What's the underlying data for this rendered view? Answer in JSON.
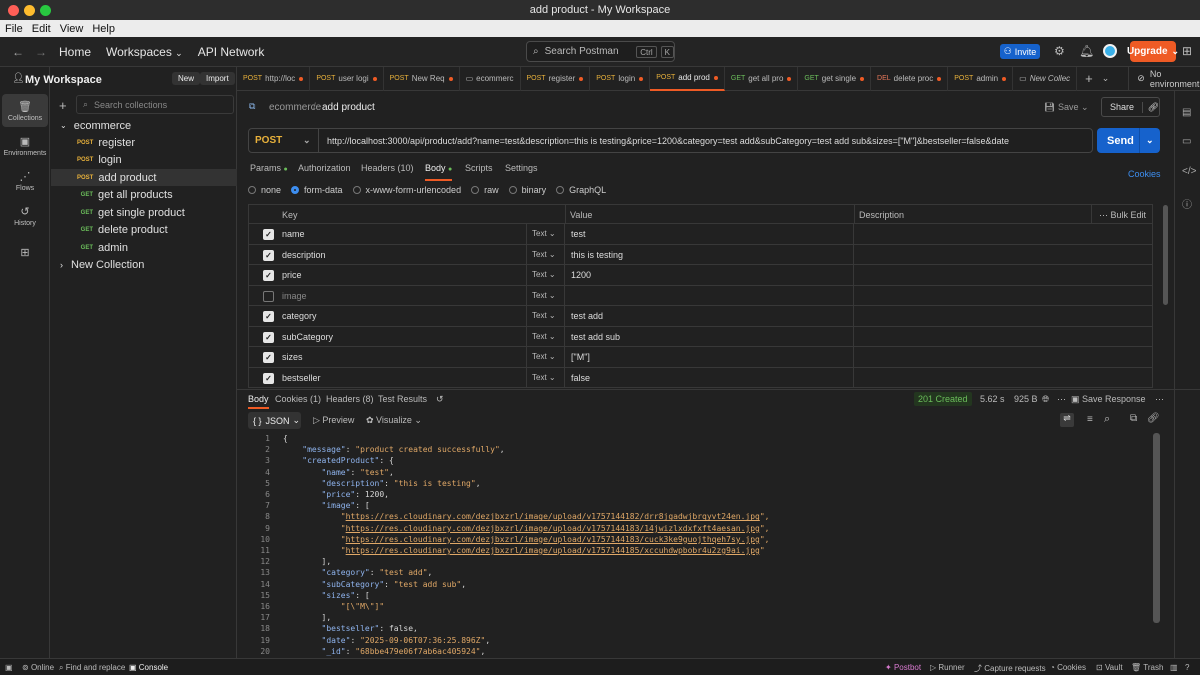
{
  "window": {
    "title": "add product - My Workspace"
  },
  "menu": [
    "File",
    "Edit",
    "View",
    "Help"
  ],
  "topnav": {
    "home": "Home",
    "workspaces": "Workspaces",
    "api_network": "API Network",
    "search_placeholder": "Search Postman",
    "kbd_ctrl": "Ctrl",
    "kbd_k": "K",
    "invite": "Invite",
    "upgrade": "Upgrade"
  },
  "rail": [
    {
      "label": "Collections",
      "icon": "collections-icon"
    },
    {
      "label": "Environments",
      "icon": "environments-icon"
    },
    {
      "label": "Flows",
      "icon": "flows-icon"
    },
    {
      "label": "History",
      "icon": "history-icon"
    }
  ],
  "sidebar": {
    "workspace": "My Workspace",
    "new": "New",
    "import": "Import",
    "search_placeholder": "Search collections",
    "collection": "ecommerce",
    "items": [
      {
        "method": "POST",
        "name": "register"
      },
      {
        "method": "POST",
        "name": "login"
      },
      {
        "method": "POST",
        "name": "add product"
      },
      {
        "method": "GET",
        "name": "get all products"
      },
      {
        "method": "GET",
        "name": "get single product"
      },
      {
        "method": "GET",
        "name": "delete product"
      },
      {
        "method": "GET",
        "name": "admin"
      }
    ],
    "new_collection": "New Collection"
  },
  "tabs": [
    {
      "method": "POST",
      "name": "http://loc"
    },
    {
      "method": "POST",
      "name": "user logi"
    },
    {
      "method": "POST",
      "name": "New Req"
    },
    {
      "method": "",
      "name": "ecommerc"
    },
    {
      "method": "POST",
      "name": "register"
    },
    {
      "method": "POST",
      "name": "login"
    },
    {
      "method": "POST",
      "name": "add prod"
    },
    {
      "method": "GET",
      "name": "get all pro"
    },
    {
      "method": "GET",
      "name": "get single"
    },
    {
      "method": "DEL",
      "name": "delete proc"
    },
    {
      "method": "POST",
      "name": "admin"
    },
    {
      "method": "",
      "name": "New Collec"
    }
  ],
  "environment": "No environment",
  "breadcrumb": {
    "collection": "ecommerce",
    "sep": "/",
    "request": "add product"
  },
  "actions": {
    "save": "Save",
    "share": "Share"
  },
  "request": {
    "method": "POST",
    "url": "http://localhost:3000/api/product/add?name=test&description=this is testing&price=1200&category=test add&subCategory=test add sub&sizes=[\"M\"]&bestseller=false&date",
    "send": "Send",
    "tabs": [
      "Params",
      "Authorization",
      "Headers (10)",
      "Body",
      "Scripts",
      "Settings"
    ],
    "cookies": "Cookies",
    "body_types": [
      "none",
      "form-data",
      "x-www-form-urlencoded",
      "raw",
      "binary",
      "GraphQL"
    ],
    "body_selected": "form-data"
  },
  "formdata": {
    "headers": {
      "key": "Key",
      "value": "Value",
      "description": "Description",
      "bulk": "Bulk Edit"
    },
    "rows": [
      {
        "checked": true,
        "key": "name",
        "type": "Text",
        "value": "test"
      },
      {
        "checked": true,
        "key": "description",
        "type": "Text",
        "value": "this is testing"
      },
      {
        "checked": true,
        "key": "price",
        "type": "Text",
        "value": "1200"
      },
      {
        "checked": false,
        "key": "image",
        "type": "Text",
        "value": ""
      },
      {
        "checked": true,
        "key": "category",
        "type": "Text",
        "value": "test add"
      },
      {
        "checked": true,
        "key": "subCategory",
        "type": "Text",
        "value": "test add sub"
      },
      {
        "checked": true,
        "key": "sizes",
        "type": "Text",
        "value": "[\"M\"]"
      },
      {
        "checked": true,
        "key": "bestseller",
        "type": "Text",
        "value": "false"
      }
    ]
  },
  "response": {
    "tabs": [
      "Body",
      "Cookies (1)",
      "Headers (8)",
      "Test Results"
    ],
    "status": "201 Created",
    "time": "5.62 s",
    "size": "925 B",
    "save": "Save Response",
    "format": "JSON",
    "preview": "Preview",
    "visualize": "Visualize",
    "lines": [
      [
        {
          "t": "{",
          "c": "n"
        }
      ],
      [
        {
          "t": "    ",
          "c": "n"
        },
        {
          "t": "\"message\"",
          "c": "k"
        },
        {
          "t": ": ",
          "c": "n"
        },
        {
          "t": "\"product created successfully\"",
          "c": "s"
        },
        {
          "t": ",",
          "c": "n"
        }
      ],
      [
        {
          "t": "    ",
          "c": "n"
        },
        {
          "t": "\"createdProduct\"",
          "c": "k"
        },
        {
          "t": ": {",
          "c": "n"
        }
      ],
      [
        {
          "t": "        ",
          "c": "n"
        },
        {
          "t": "\"name\"",
          "c": "k"
        },
        {
          "t": ": ",
          "c": "n"
        },
        {
          "t": "\"test\"",
          "c": "s"
        },
        {
          "t": ",",
          "c": "n"
        }
      ],
      [
        {
          "t": "        ",
          "c": "n"
        },
        {
          "t": "\"description\"",
          "c": "k"
        },
        {
          "t": ": ",
          "c": "n"
        },
        {
          "t": "\"this is testing\"",
          "c": "s"
        },
        {
          "t": ",",
          "c": "n"
        }
      ],
      [
        {
          "t": "        ",
          "c": "n"
        },
        {
          "t": "\"price\"",
          "c": "k"
        },
        {
          "t": ": 1200,",
          "c": "n"
        }
      ],
      [
        {
          "t": "        ",
          "c": "n"
        },
        {
          "t": "\"image\"",
          "c": "k"
        },
        {
          "t": ": [",
          "c": "n"
        }
      ],
      [
        {
          "t": "            \"",
          "c": "s"
        },
        {
          "t": "https://res.cloudinary.com/dezjbxzrl/image/upload/v1757144182/drr8jgadwjbrqyvt24en.jpg",
          "c": "u"
        },
        {
          "t": "\",",
          "c": "s"
        }
      ],
      [
        {
          "t": "            \"",
          "c": "s"
        },
        {
          "t": "https://res.cloudinary.com/dezjbxzrl/image/upload/v1757144183/14jwizlxdxfxft4aesan.jpg",
          "c": "u"
        },
        {
          "t": "\",",
          "c": "s"
        }
      ],
      [
        {
          "t": "            \"",
          "c": "s"
        },
        {
          "t": "https://res.cloudinary.com/dezjbxzrl/image/upload/v1757144183/cuck3ke9guojthqeh7sy.jpg",
          "c": "u"
        },
        {
          "t": "\",",
          "c": "s"
        }
      ],
      [
        {
          "t": "            \"",
          "c": "s"
        },
        {
          "t": "https://res.cloudinary.com/dezjbxzrl/image/upload/v1757144185/xccuhdwpbobr4u2zg9ai.jpg",
          "c": "u"
        },
        {
          "t": "\"",
          "c": "s"
        }
      ],
      [
        {
          "t": "        ],",
          "c": "n"
        }
      ],
      [
        {
          "t": "        ",
          "c": "n"
        },
        {
          "t": "\"category\"",
          "c": "k"
        },
        {
          "t": ": ",
          "c": "n"
        },
        {
          "t": "\"test add\"",
          "c": "s"
        },
        {
          "t": ",",
          "c": "n"
        }
      ],
      [
        {
          "t": "        ",
          "c": "n"
        },
        {
          "t": "\"subCategory\"",
          "c": "k"
        },
        {
          "t": ": ",
          "c": "n"
        },
        {
          "t": "\"test add sub\"",
          "c": "s"
        },
        {
          "t": ",",
          "c": "n"
        }
      ],
      [
        {
          "t": "        ",
          "c": "n"
        },
        {
          "t": "\"sizes\"",
          "c": "k"
        },
        {
          "t": ": [",
          "c": "n"
        }
      ],
      [
        {
          "t": "            ",
          "c": "n"
        },
        {
          "t": "\"[\\\"M\\\"]\"",
          "c": "s"
        }
      ],
      [
        {
          "t": "        ],",
          "c": "n"
        }
      ],
      [
        {
          "t": "        ",
          "c": "n"
        },
        {
          "t": "\"bestseller\"",
          "c": "k"
        },
        {
          "t": ": false,",
          "c": "n"
        }
      ],
      [
        {
          "t": "        ",
          "c": "n"
        },
        {
          "t": "\"date\"",
          "c": "k"
        },
        {
          "t": ": ",
          "c": "n"
        },
        {
          "t": "\"2025-09-06T07:36:25.896Z\"",
          "c": "s"
        },
        {
          "t": ",",
          "c": "n"
        }
      ],
      [
        {
          "t": "        ",
          "c": "n"
        },
        {
          "t": "\"_id\"",
          "c": "k"
        },
        {
          "t": ": ",
          "c": "n"
        },
        {
          "t": "\"68bbe479e06f7ab6ac405924\"",
          "c": "s"
        },
        {
          "t": ",",
          "c": "n"
        }
      ]
    ]
  },
  "status_bar": {
    "online": "Online",
    "find": "Find and replace",
    "console": "Console",
    "postbot": "Postbot",
    "runner": "Runner",
    "capture": "Capture requests",
    "cookies": "Cookies",
    "vault": "Vault",
    "trash": "Trash"
  },
  "colors": {
    "accent": "#ef5b25",
    "send": "#1662cc",
    "status_ok": "#6bbd5b"
  }
}
